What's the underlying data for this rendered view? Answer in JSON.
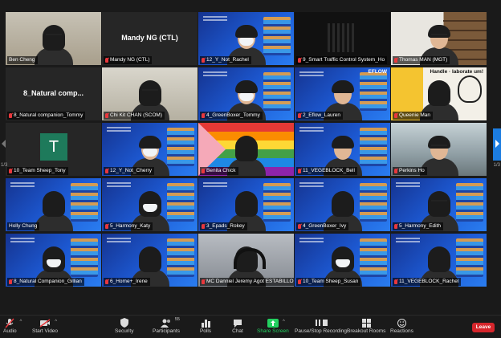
{
  "app": "Zoom Meeting",
  "gallery": {
    "page_left": "1/3",
    "page_right": "1/3",
    "tiles": [
      {
        "name": "Ben Cheng",
        "bg": "room",
        "muted": false
      },
      {
        "name": "Mandy NG (CTL)",
        "bg": "dark",
        "center_text": "Mandy NG (CTL)",
        "muted": true
      },
      {
        "name": "12_Y_Not_Rachel",
        "bg": "blue",
        "muted": true
      },
      {
        "name": "9_Smart Traffic Control System_Ho",
        "bg": "black",
        "muted": true
      },
      {
        "name": "Thomas MAN (MGT)",
        "bg": "shelf",
        "muted": true
      },
      {
        "name": "8_Natural companion_Tommy",
        "bg": "dark",
        "center_text": "8_Natural comp...",
        "muted": true
      },
      {
        "name": "Chi Kit CHAN (SCOM)",
        "bg": "office",
        "muted": true
      },
      {
        "name": "4_GreenBoxer_Tommy",
        "bg": "blue",
        "muted": true
      },
      {
        "name": "2_Eflow_Lauren",
        "bg": "blue",
        "muted": true,
        "overlay_text": "EFLOW"
      },
      {
        "name": "Queenie Man",
        "bg": "collab",
        "muted": true,
        "overlay_text": "Handle · laborate um!"
      },
      {
        "name": "10_Team Sheep_Tony",
        "bg": "dark",
        "initial": "T",
        "muted": true
      },
      {
        "name": "12_Y_Not_Cherry",
        "bg": "blue",
        "muted": true
      },
      {
        "name": "Benita Chick",
        "bg": "rainbow",
        "muted": true
      },
      {
        "name": "11_VEGEBLOCK_Bell",
        "bg": "blue",
        "muted": true
      },
      {
        "name": "Perkins Ho",
        "bg": "window",
        "muted": true
      },
      {
        "name": "Holly Chung",
        "bg": "blue",
        "muted": false,
        "speaking": true
      },
      {
        "name": "5_Harmony_Katy",
        "bg": "blue",
        "muted": true
      },
      {
        "name": "3_Epads_Rokey",
        "bg": "blue",
        "muted": true
      },
      {
        "name": "4_GreenBoxer_Ivy",
        "bg": "blue",
        "muted": true
      },
      {
        "name": "5_Harmony_Edith",
        "bg": "blue",
        "muted": true
      },
      {
        "name": "8_Natural Companion_Gillian",
        "bg": "blue",
        "muted": true
      },
      {
        "name": "6_Home+_Irene",
        "bg": "blue",
        "muted": true
      },
      {
        "name": "MC Danniel Jeremy Agot ESTABILLO",
        "bg": "room2",
        "muted": true
      },
      {
        "name": "10_Team Sheep_Susan",
        "bg": "blue",
        "muted": true
      },
      {
        "name": "11_VEGEBLOCK_Rachel",
        "bg": "blue",
        "muted": true
      }
    ]
  },
  "toolbar": {
    "audio": "Audio",
    "video": "Start Video",
    "security": "Security",
    "participants": "Participants",
    "participants_count": "55",
    "polls": "Polls",
    "chat": "Chat",
    "share": "Share Screen",
    "record": "Pause/Stop Recording",
    "breakout": "Breakout Rooms",
    "reactions": "Reactions",
    "leave": "Leave"
  },
  "colors": {
    "speaking_border": "#d9df3b",
    "share_green": "#23d160",
    "leave_red": "#d6262c",
    "nav_blue": "#1c7ce0"
  }
}
